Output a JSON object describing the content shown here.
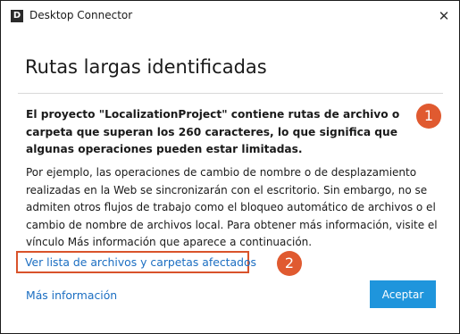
{
  "window": {
    "app_icon_letter": "D",
    "title": "Desktop Connector",
    "close_glyph": "✕"
  },
  "dialog": {
    "heading": "Rutas largas identificadas",
    "bold_message": "El proyecto \"LocalizationProject\" contiene rutas de archivo o carpeta que superan los 260 caracteres, lo que significa que algunas operaciones pueden estar limitadas.",
    "info_message": "Por ejemplo, las operaciones de cambio de nombre o de desplazamiento realizadas en la Web se sincronizarán con el escritorio. Sin embargo, no se admiten otros flujos de trabajo como el bloqueo automático de archivos o el cambio de nombre de archivos local. Para obtener más información, visite el vínculo Más información que aparece a continuación.",
    "file_list_link": "Ver lista de archivos y carpetas afectados",
    "more_info_link": "Más información",
    "accept_button": "Aceptar"
  },
  "callouts": {
    "one": "1",
    "two": "2"
  },
  "colors": {
    "accent": "#1f95dc",
    "link": "#1b6ec2",
    "callout": "#e05a30"
  }
}
